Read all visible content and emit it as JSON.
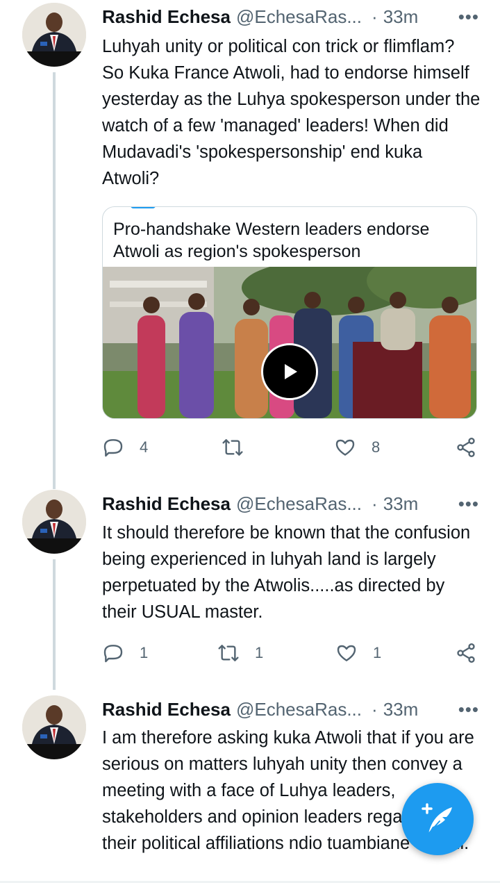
{
  "tweets": [
    {
      "name": "Rashid Echesa",
      "handle": "@EchesaRas...",
      "dot": "·",
      "time": "33m",
      "more": "•••",
      "text": "Luhyah unity or political con trick or flimflam? So Kuka France Atwoli, had to endorse himself yesterday as the Luhya spokesperson under the watch of a few 'managed' leaders! When did Mudavadi's 'spokespersonship' end kuka Atwoli?",
      "card": {
        "title": "Pro-handshake Western leaders endorse Atwoli as region's spokesperson"
      },
      "replies": "4",
      "retweets": "",
      "likes": "8"
    },
    {
      "name": "Rashid Echesa",
      "handle": "@EchesaRas...",
      "dot": "·",
      "time": "33m",
      "more": "•••",
      "text": "It should therefore be known that the confusion being experienced in luhyah land is largely perpetuated by the Atwolis.....as directed by their USUAL master.",
      "replies": "1",
      "retweets": "1",
      "likes": "1"
    },
    {
      "name": "Rashid Echesa",
      "handle": "@EchesaRas...",
      "dot": "·",
      "time": "33m",
      "more": "•••",
      "text": "I am therefore asking kuka Atwoli that if you are serious on matters luhyah unity then convey a meeting with a face of Luhya leaders, stakeholders and opinion leaders regardless of their political affiliations ndio tuambiane ukweli."
    }
  ],
  "colors": {
    "accent": "#1d9bf0",
    "secondary_text": "#536471",
    "thread_line": "#cfd9de"
  },
  "icons": {
    "reply": "reply-icon",
    "retweet": "retweet-icon",
    "like": "heart-icon",
    "share": "share-icon",
    "compose": "compose-tweet-icon",
    "play": "play-icon"
  }
}
